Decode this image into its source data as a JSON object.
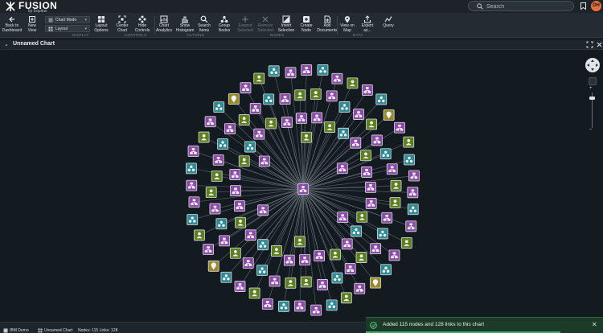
{
  "app": {
    "logo_title": "FUSION",
    "logo_subtitle": "by Equitus"
  },
  "topbar": {
    "search_placeholder": "Search",
    "user_initials": "DH"
  },
  "toolbar": {
    "chart_mode_label": "Chart Mode",
    "layout_label": "Layout",
    "tools": [
      {
        "label": "Back to\nDashboard",
        "icon": "arrow-left-icon",
        "enabled": true
      },
      {
        "label": "New\nView",
        "icon": "new-view-icon",
        "enabled": true
      },
      {
        "label": "Layout\nOptions",
        "icon": "layout-options-icon",
        "enabled": true
      },
      {
        "label": "Center\nChart",
        "icon": "center-chart-icon",
        "enabled": true
      },
      {
        "label": "Hide\nControls",
        "icon": "hide-controls-icon",
        "enabled": true
      },
      {
        "label": "Chart\nAnalytics",
        "icon": "analytics-icon",
        "enabled": true
      },
      {
        "label": "Show\nHistogram",
        "icon": "histogram-icon",
        "enabled": true
      },
      {
        "label": "Search\nItems",
        "icon": "search-items-icon",
        "enabled": true
      },
      {
        "label": "Group\nNodes",
        "icon": "group-nodes-icon",
        "enabled": true
      },
      {
        "label": "Expand\nSelected",
        "icon": "expand-icon",
        "enabled": false
      },
      {
        "label": "Remove\nSelected",
        "icon": "remove-icon",
        "enabled": false
      },
      {
        "label": "Invert\nSelection",
        "icon": "invert-icon",
        "enabled": true
      },
      {
        "label": "Create\nNode",
        "icon": "create-node-icon",
        "enabled": true
      },
      {
        "label": "Add\nDocuments",
        "icon": "add-documents-icon",
        "enabled": true
      },
      {
        "label": "View on\nMap",
        "icon": "map-pin-icon",
        "enabled": true
      },
      {
        "label": "Export\nas...",
        "icon": "export-icon",
        "enabled": true
      },
      {
        "label": "Query",
        "icon": "query-icon",
        "enabled": true
      }
    ],
    "groups": [
      "DISPLAY",
      "CONTROLS",
      "ACTIONS",
      "NODES",
      "DATA"
    ]
  },
  "panel": {
    "title": "Unnamed Chart"
  },
  "graph": {
    "colors": {
      "organization": "#8e4aa8",
      "person": "#5e7f1e",
      "group": "#2e8a94",
      "location": "#9a8a25",
      "edge": "#7f8a94"
    }
  },
  "bottom_tabs": {
    "workspace": "IBM Demo",
    "chart": "Unnamed Chart",
    "stats": "Nodes: 115  Links: 128"
  },
  "toast": {
    "message": "Added 115 nodes and 128 links to this chart",
    "progress": 0.82
  }
}
